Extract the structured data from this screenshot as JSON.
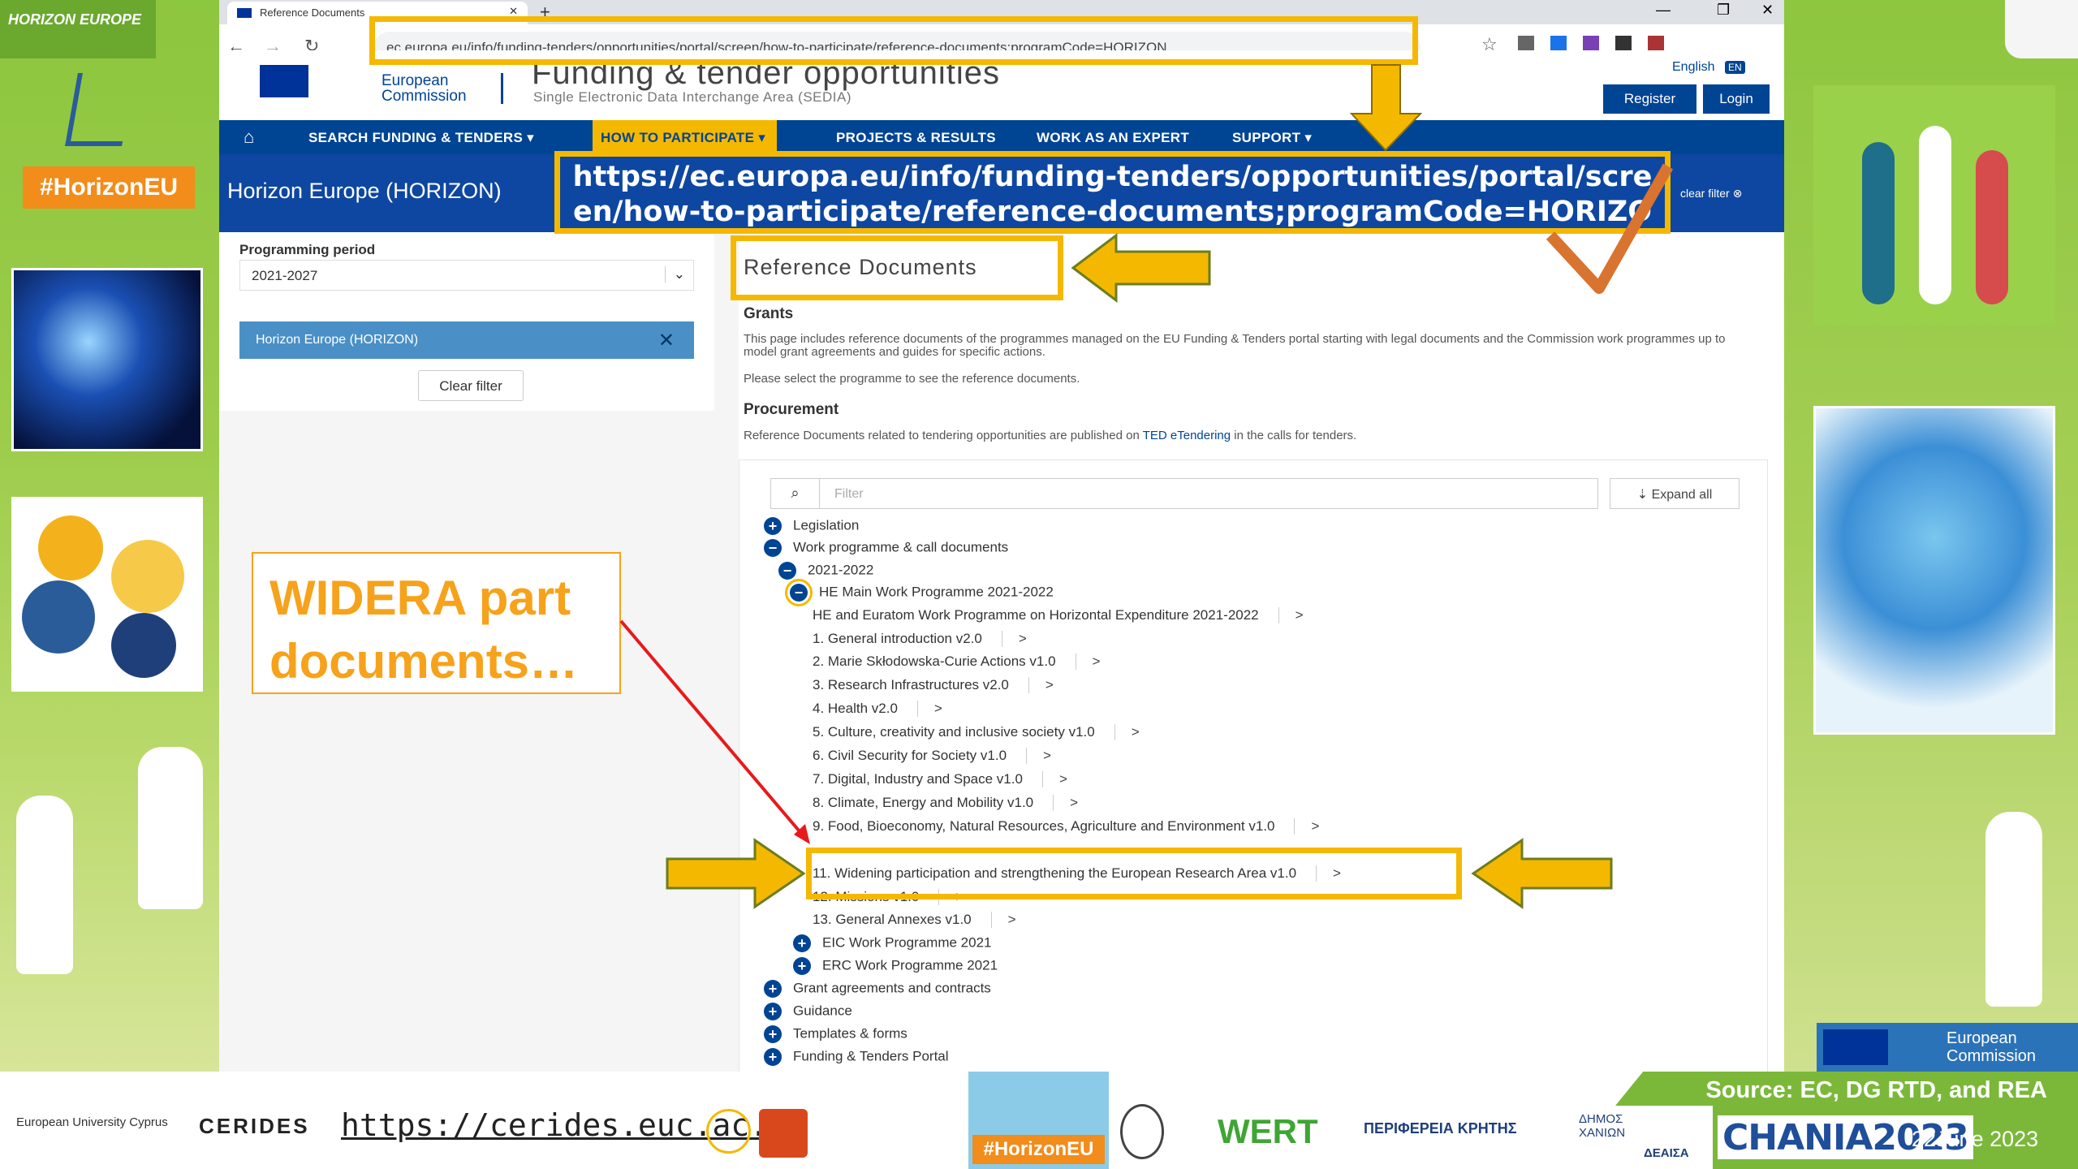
{
  "slide": {
    "callout": "WIDERA part documents…",
    "big_url": "https://ec.europa.eu/info/funding-tenders/opportunities/portal/screen/how-to-participate/reference-documents;programCode=HORIZON",
    "hashtag": "#HorizonEU",
    "logo_text": "HORIZON EUROPE",
    "ec_label": "European Commission",
    "source": "Source: EC, DG RTD, and REA",
    "date": "22June 2023",
    "cerides_url": "https://cerides.euc.ac.cy",
    "footer_logos": [
      "European University Cyprus",
      "CERIDES",
      "WERT",
      "ΠΕΡΙΦΕΡΕΙΑ ΚΡΗΤΗΣ",
      "ΔΗΜΟΣ ΧΑΝΙΩΝ",
      "ΔΕΑΙΣΑ",
      "CHANIA2023"
    ]
  },
  "browser": {
    "tab_title": "Reference Documents",
    "url": "ec.europa.eu/info/funding-tenders/opportunities/portal/screen/how-to-participate/reference-documents;programCode=HORIZON"
  },
  "header": {
    "ec_name": "European Commission",
    "site_title": "Funding & tender opportunities",
    "subtitle": "Single Electronic Data Interchange Area (SEDIA)",
    "language": "English",
    "lang_code": "EN",
    "register": "Register",
    "login": "Login"
  },
  "nav": [
    "SEARCH FUNDING & TENDERS",
    "HOW TO PARTICIPATE",
    "PROJECTS & RESULTS",
    "WORK AS AN EXPERT",
    "SUPPORT"
  ],
  "banner": {
    "program": "Horizon Europe (HORIZON)",
    "clear": "clear filter"
  },
  "sidebar": {
    "period_label": "Programming period",
    "period_value": "2021-2027",
    "selected": "Horizon Europe (HORIZON)",
    "clear_button": "Clear filter"
  },
  "main": {
    "title": "Reference Documents",
    "grants_heading": "Grants",
    "grants_text": "This page includes reference documents of the programmes managed on the EU Funding & Tenders portal starting with legal documents and the Commission work programmes up to model grant agreements and guides for specific actions.",
    "select_text": "Please select the programme to see the reference documents.",
    "procurement_heading": "Procurement",
    "procurement_text_a": "Reference Documents related to tendering opportunities are published on",
    "procurement_link": "TED eTendering",
    "procurement_text_b": "in the calls for tenders.",
    "filter_placeholder": "Filter",
    "expand_all": "Expand all"
  },
  "tree": {
    "legislation": "Legislation",
    "wp": "Work programme & call documents",
    "year": "2021-2022",
    "he_main": "HE Main Work Programme 2021-2022",
    "items": [
      "HE and Euratom Work Programme on Horizontal Expenditure 2021-2022",
      "1. General introduction v2.0",
      "2. Marie Skłodowska-Curie Actions v1.0",
      "3. Research Infrastructures v2.0",
      "4. Health v2.0",
      "5. Culture, creativity and inclusive society v1.0",
      "6. Civil Security for Society v1.0",
      "7. Digital, Industry and Space v1.0",
      "8. Climate, Energy and Mobility v1.0",
      "9. Food, Bioeconomy, Natural Resources, Agriculture and Environment v1.0",
      "11. Widening participation and strengthening the European Research Area v1.0",
      "12. Missions v1.0",
      "13. General Annexes v1.0"
    ],
    "eic": "EIC Work Programme 2021",
    "erc": "ERC Work Programme 2021",
    "grant_agreements": "Grant agreements and contracts",
    "guidance": "Guidance",
    "templates": "Templates & forms",
    "portal": "Funding & Tenders Portal"
  },
  "colors": {
    "accent": "#f5b800",
    "ec_blue": "#004494",
    "callout": "#f7a21b",
    "slide_green": "#8dc63f"
  }
}
